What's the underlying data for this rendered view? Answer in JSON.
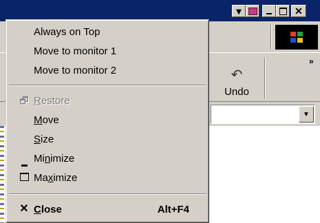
{
  "system_menu": {
    "items": [
      {
        "label": "Always on Top"
      },
      {
        "label": "Move to monitor 1"
      },
      {
        "label": "Move to monitor 2"
      },
      {
        "label_pre": "",
        "label_mn": "R",
        "label_post": "estore",
        "icon": "restore-icon",
        "disabled": true
      },
      {
        "label_pre": "",
        "label_mn": "M",
        "label_post": "ove"
      },
      {
        "label_pre": "",
        "label_mn": "S",
        "label_post": "ize"
      },
      {
        "label_pre": "Mi",
        "label_mn": "n",
        "label_post": "imize",
        "icon": "minimize-icon"
      },
      {
        "label_pre": "Ma",
        "label_mn": "x",
        "label_post": "imize",
        "icon": "maximize-icon"
      },
      {
        "label_pre": "",
        "label_mn": "C",
        "label_post": "lose",
        "icon": "close-icon",
        "shortcut": "Alt+F4",
        "bold": true
      }
    ]
  },
  "toolbar": {
    "undo_label": "Undo"
  },
  "colors": {
    "titlebar": "#0a246a",
    "chrome": "#d4d0c8",
    "shadow": "#808080"
  }
}
